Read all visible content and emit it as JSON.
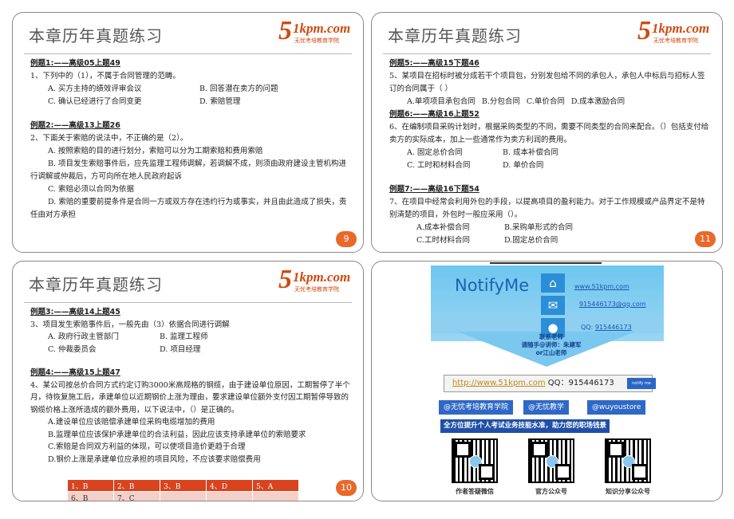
{
  "common": {
    "slide_title": "本章历年真题练习",
    "logo_domain": "1kpm.com",
    "logo_slogan": "无忧考培教育学院"
  },
  "slide9": {
    "page": "9",
    "q1_head": "例题1:——高级05上题49",
    "q1_stem": "1、下列中的（1），不属于合同管理的范畴。",
    "q1_opts": [
      "A. 买方主持的绩效评审会议",
      "B. 回答潜在卖方的问题",
      "C. 确认已经进行了合同变更",
      "D. 索赔管理"
    ],
    "q2_head": "例题2:——高级13上题26",
    "q2_stem": "2、下面关于索赔的说法中，不正确的是（2）。",
    "q2_a": "A. 按照索赔的目的进行划分，索赔可以分为工期索赔和费用索赔",
    "q2_b": "B. 项目发生索赔事件后，应先监理工程师调解，若调解不成，则须由政府建设主管机构进行调解或仲裁后，方可向所在地人民政府起诉",
    "q2_c": "C. 索赔必须以合同为依据",
    "q2_d": "D. 索赔的重要前提条件是合同一方或双方存在违约行为或事实，并且由此造成了损失，责任由对方承担"
  },
  "slide11": {
    "page": "11",
    "q5_head": "例题5:——高级15下题46",
    "q5_stem": "5、某项目在招标时被分成若干个项目包，分别发包给不同的承包人，承包人中标后与招标人签订的合同属于（ ）",
    "q5_opts": [
      "A.单项项目承包合同",
      "B.分包合同",
      "C.单价合同",
      "D.成本激励合同"
    ],
    "q6_head": "例题6:——高级16上题52",
    "q6_stem": "6、在编制项目采购计划时，根据采购类型的不同，需要不同类型的合同来配合。（）包括支付给卖方的实际成本，加上一些通常作为卖方利润的费用。",
    "q6_opts": [
      "A. 固定总价合同",
      "B. 成本补偿合同",
      "C. 工时和材料合同",
      "D. 单价合同"
    ],
    "q7_head": "例题7:——高级16下题54",
    "q7_stem": "7、在项目中经常会利用外包的手段，以提高项目的盈利能力。对于工作规模或产品界定不是特别清楚的项目，外包时一般应采用（）。",
    "q7_opts": [
      "A.成本补偿合同",
      "B.采购单形式的合同",
      "C.工时材料合同",
      "D.固定总价合同"
    ]
  },
  "slide10": {
    "page": "10",
    "q3_head": "例题3:——高级14上题45",
    "q3_stem": "3、项目发生索赔事件后，一般先由（3）依据合同进行调解",
    "q3_opts": [
      "A. 政府行政主管部门",
      "B. 监理工程师",
      "C. 仲裁委员会",
      "D. 项目经理"
    ],
    "q4_head": "例题4:——高级15上题47",
    "q4_stem": "4、某公司按总价合同方式约定订购3000米高规格的钢缆，由于建设单位原因，工期暂停了半个月，待恢复施工后，承建单位以近期钢价上涨为理由，要求建设单位额外支付因工期暂停导致的钢缆价格上涨所造成的额外费用，以下说法中，（）是正确的。",
    "q4_opts": [
      "A.建设单位应该赔偿承建单位采购电缆增加的费用",
      "B.监理单位应该保护承建单位的合法利益，因此应该支持承建单位的索赔要求",
      "C.索赔是合同双方利益的体现，可以使项目造价更趋于合理",
      "D.钢价上涨是承建单位应承担的项目风险，不应该要求赔偿费用"
    ],
    "answers_row1": [
      "1、B",
      "2、B",
      "3、B",
      "4、D",
      "5、A"
    ],
    "answers_row2": [
      "6、B",
      "7、C",
      "",
      "",
      ""
    ]
  },
  "ad": {
    "title": "NotifyMe",
    "link_web": "www.51kpm.com",
    "link_mail": "915446173@qq.com",
    "qq_label": "QQ:",
    "qq_value": "915446173",
    "teacher_1": "联系老师",
    "teacher_2": "请随手@讲师：朱建军",
    "teacher_3": "or江山老师",
    "bar_url": "http://www.51kpm.com",
    "bar_qq": "QQ：915446173",
    "notify_btn": "notify me",
    "tag1": "@无忧考培教育学院",
    "tag2": "@无忧教学",
    "tag3": "@wuyoustore",
    "banner": "全方位提升个人考试业务技能水准，助力您的职场钱景",
    "qr1_caption": "作者答疑微信",
    "qr2_caption": "官方公众号",
    "qr3_caption": "知识分享公众号",
    "icons": [
      "home-icon",
      "mail-icon",
      "person-icon"
    ]
  }
}
